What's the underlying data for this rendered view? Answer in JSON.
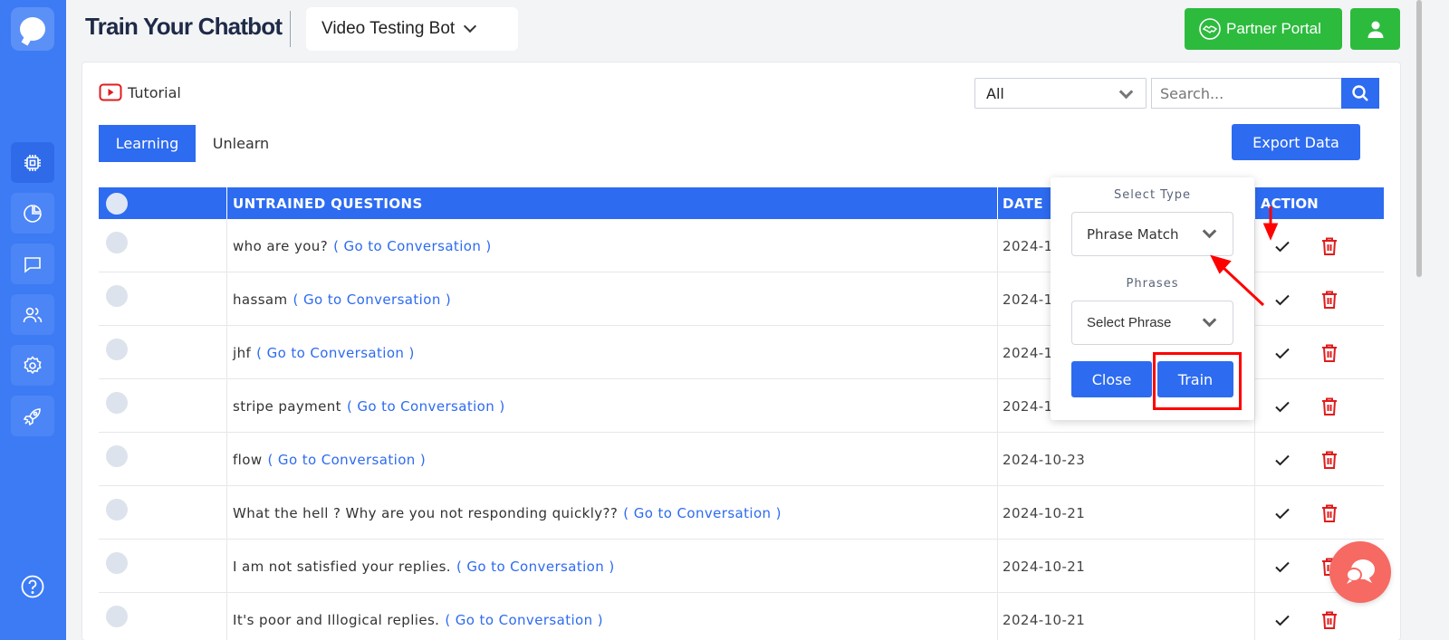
{
  "header": {
    "app_title": "Train Your Chatbot",
    "bot_name": "Video Testing Bot",
    "partner_label": "Partner Portal"
  },
  "toolbar": {
    "tutorial_label": "Tutorial",
    "filter_value": "All",
    "search_placeholder": "Search...",
    "export_label": "Export Data"
  },
  "tabs": [
    {
      "label": "Learning",
      "active": true
    },
    {
      "label": "Unlearn",
      "active": false
    }
  ],
  "table": {
    "columns": [
      "UNTRAINED QUESTIONS",
      "DATE",
      "ACTION"
    ],
    "goto_label": "( Go to Conversation )",
    "rows": [
      {
        "question": "who are you?",
        "date": "2024-1"
      },
      {
        "question": "hassam",
        "date": "2024-1"
      },
      {
        "question": "jhf",
        "date": "2024-1"
      },
      {
        "question": "stripe payment",
        "date": "2024-1"
      },
      {
        "question": "flow",
        "date": "2024-10-23"
      },
      {
        "question": "What the hell ? Why are you not responding quickly??",
        "date": "2024-10-21"
      },
      {
        "question": "I am not satisfied your replies.",
        "date": "2024-10-21"
      },
      {
        "question": "It's poor and Illogical replies.",
        "date": "2024-10-21"
      }
    ]
  },
  "popup": {
    "type_label": "Select Type",
    "type_value": "Phrase Match",
    "phrases_label": "Phrases",
    "phrase_value": "Select Phrase",
    "close_label": "Close",
    "train_label": "Train"
  },
  "colors": {
    "sidebar": "#3d7bf5",
    "primary": "#2d6bf0",
    "partner_green": "#2dbb3e",
    "delete_red": "#e01c1c",
    "annotation_red": "#ff0000",
    "fab": "#f66a63"
  },
  "icons": {
    "sidebar": [
      "chip-icon",
      "pie-chart-icon",
      "chat-icon",
      "users-icon",
      "gear-icon",
      "rocket-icon",
      "help-icon"
    ],
    "row_actions": [
      "check-icon",
      "trash-icon"
    ]
  }
}
